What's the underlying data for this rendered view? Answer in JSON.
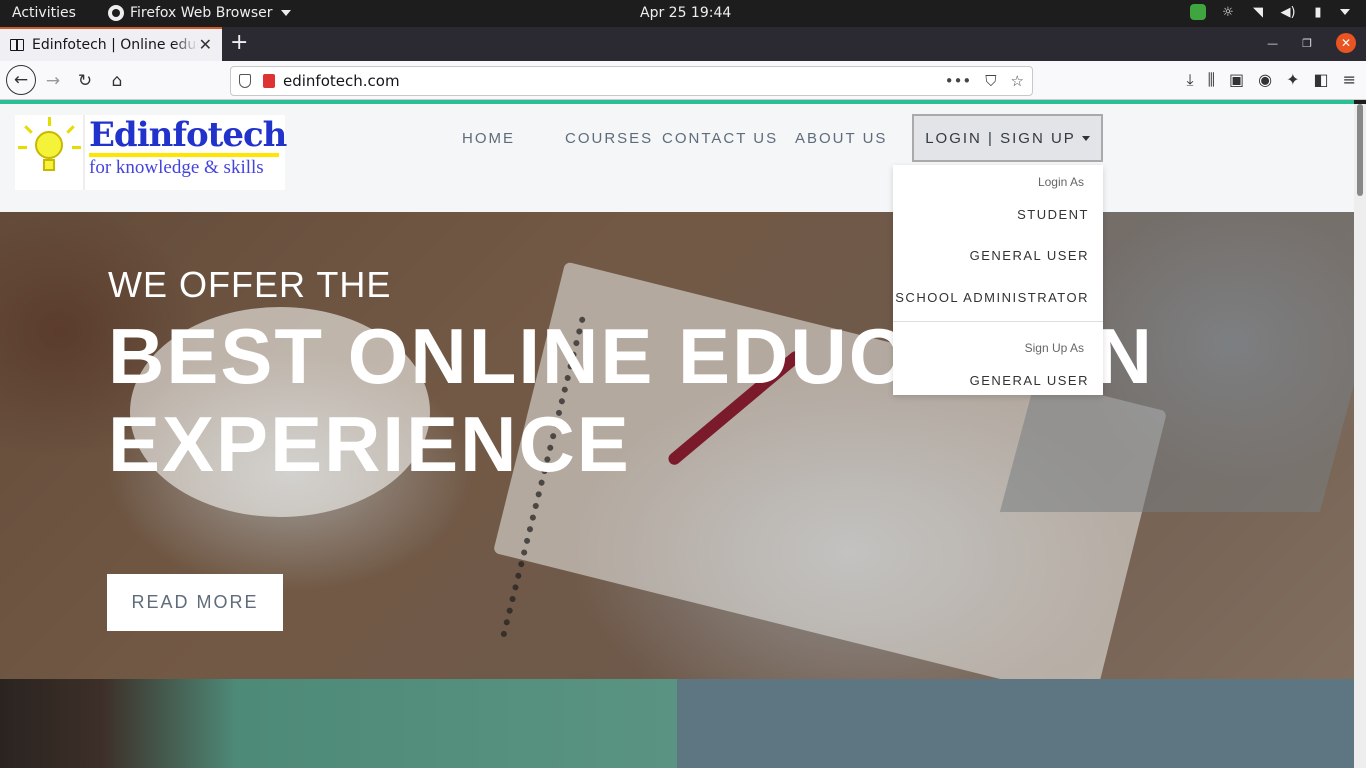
{
  "system_bar": {
    "activities": "Activities",
    "app_menu": "Firefox Web Browser",
    "clock": "Apr 25  19:44"
  },
  "browser": {
    "tab_title": "Edinfotech | Online education",
    "url": "edinfotech.com"
  },
  "site": {
    "logo": {
      "brand": "Edinfotech",
      "tagline": "for knowledge & skills"
    },
    "nav": {
      "home": "HOME",
      "courses": "COURSES",
      "contact": "CONTACT US",
      "about": "ABOUT US",
      "login_signup": "LOGIN | SIGN UP"
    },
    "dropdown": {
      "login_heading": "Login As",
      "login_items": [
        "STUDENT",
        "GENERAL USER",
        "SCHOOL ADMINISTRATOR"
      ],
      "signup_heading": "Sign Up As",
      "signup_items": [
        "GENERAL USER"
      ]
    },
    "hero": {
      "pre_title": "WE OFFER THE",
      "title_line1": "BEST ONLINE EDUCATION",
      "title_line2": "EXPERIENCE",
      "cta": "READ MORE"
    }
  },
  "colors": {
    "page_accent": "#2bbf95",
    "brand_blue": "#2233cc",
    "tab_accent": "#d05a2a",
    "close_button": "#e95420"
  }
}
